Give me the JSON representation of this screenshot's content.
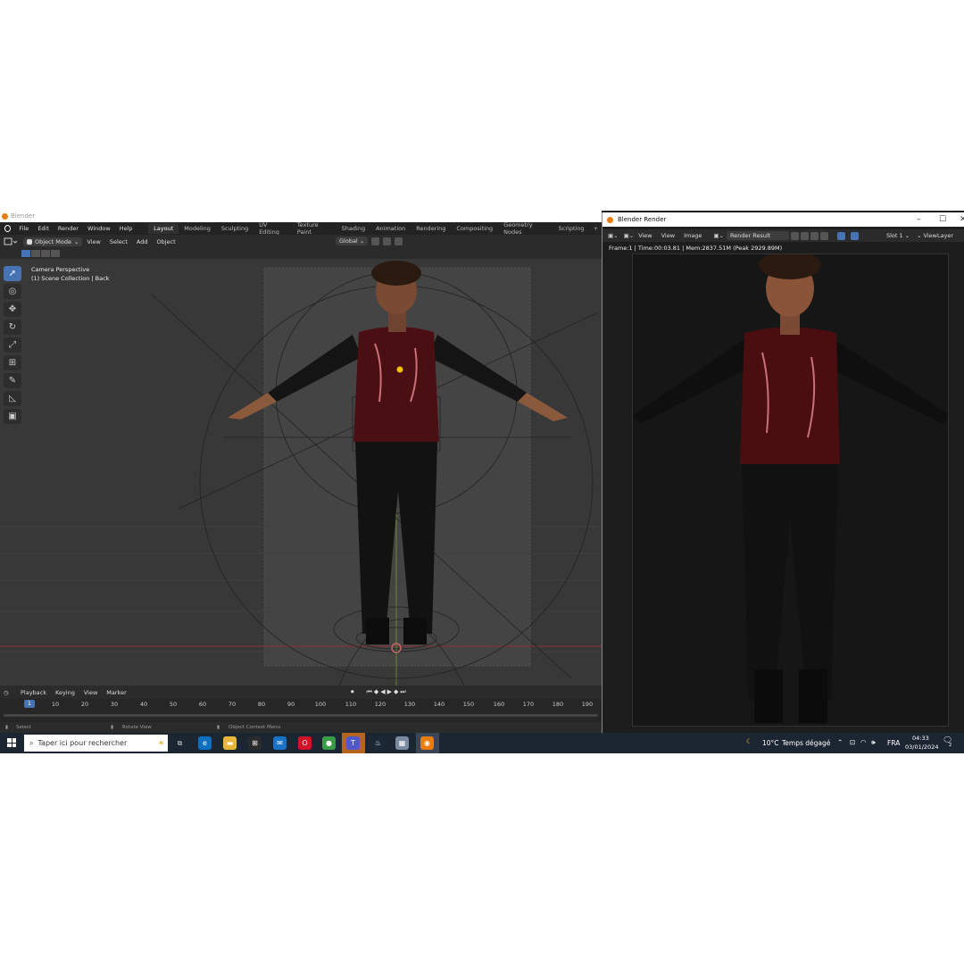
{
  "blender": {
    "window_title": "Blender",
    "menu": [
      "File",
      "Edit",
      "Render",
      "Window",
      "Help"
    ],
    "workspaces": [
      "Layout",
      "Modeling",
      "Sculpting",
      "UV Editing",
      "Texture Paint",
      "Shading",
      "Animation",
      "Rendering",
      "Compositing",
      "Geometry Nodes",
      "Scripting"
    ],
    "active_workspace": "Layout",
    "header": {
      "mode": "Object Mode",
      "menus": [
        "View",
        "Select",
        "Add",
        "Object"
      ],
      "orientation": "Global"
    },
    "viewport": {
      "line1": "Camera Perspective",
      "line2": "(1) Scene Collection | Back"
    },
    "timeline": {
      "menus": [
        "Playback",
        "Keying",
        "View",
        "Marker"
      ],
      "current_frame": "1",
      "ticks": [
        "10",
        "20",
        "30",
        "40",
        "50",
        "60",
        "70",
        "80",
        "90",
        "100",
        "110",
        "120",
        "130",
        "140",
        "150",
        "160",
        "170",
        "180",
        "190"
      ]
    },
    "status": {
      "select": "Select",
      "rotate": "Rotate View",
      "context": "Object Context Menu"
    }
  },
  "render_window": {
    "title": "Blender Render",
    "menus": [
      "View",
      "View",
      "Image"
    ],
    "result": "Render Result",
    "slot": "Slot 1",
    "view_layer": "ViewLayer",
    "info": "Frame:1 | Time:00:03.81 | Mem:2837.51M (Peak 2929.89M)"
  },
  "taskbar": {
    "search_placeholder": "Taper ici pour rechercher",
    "weather_temp": "10°C",
    "weather_text": "Temps dégagé",
    "language": "FRA",
    "time": "04:33",
    "date": "03/01/2024",
    "notification_count": "2"
  },
  "colors": {
    "blender_accent": "#4772b3",
    "blender_orange": "#e87d0d",
    "taskbar": "#1c2532"
  }
}
